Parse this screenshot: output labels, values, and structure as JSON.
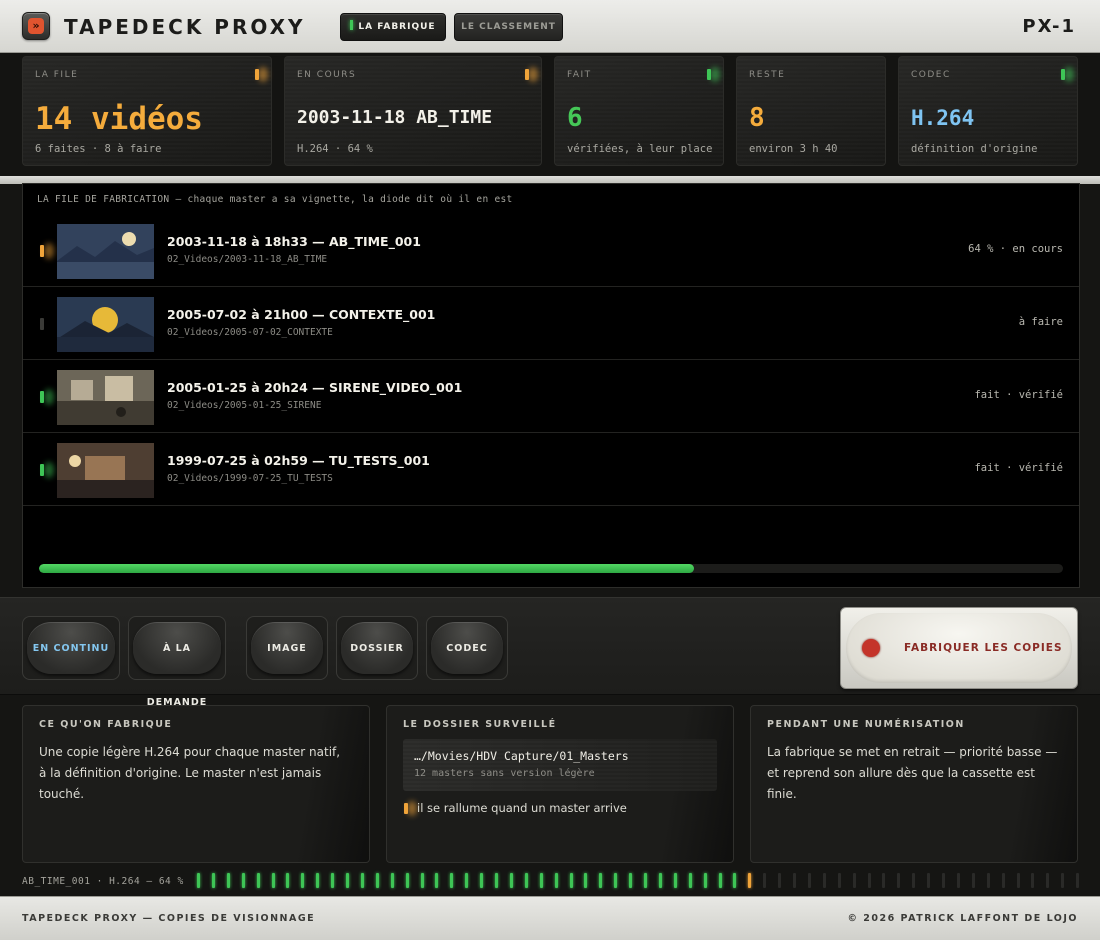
{
  "header": {
    "logo_glyph": "»",
    "title": "TAPEDECK PROXY",
    "nav": [
      {
        "label": "LA FABRIQUE",
        "active": true
      },
      {
        "label": "LE CLASSEMENT",
        "active": false
      }
    ],
    "model": "PX-1"
  },
  "stats": [
    {
      "label": "LA FILE",
      "value": "14 vidéos",
      "sub": "6 faites · 8 à faire",
      "led": "amber"
    },
    {
      "label": "EN COURS",
      "value": "2003-11-18 AB_TIME",
      "sub": "H.264 · 64 %",
      "led": "amber"
    },
    {
      "label": "FAIT",
      "value": "6",
      "sub": "vérifiées, à leur place",
      "led": "green"
    },
    {
      "label": "RESTE",
      "value": "8",
      "sub": "environ 3 h 40",
      "led": "none"
    },
    {
      "label": "CODEC",
      "value": "H.264",
      "sub": "définition d'origine",
      "led": "green"
    }
  ],
  "queue": {
    "caption": "LA FILE DE FABRICATION — chaque master a sa vignette, la diode dit où il en est",
    "items": [
      {
        "title": "2003-11-18 à 18h33 — AB_TIME_001",
        "path": "02_Videos/2003-11-18_AB_TIME",
        "status": "64 % · en cours",
        "led": "amber",
        "thumb": "night-mountains"
      },
      {
        "title": "2005-07-02 à 21h00 — CONTEXTE_001",
        "path": "02_Videos/2005-07-02_CONTEXTE",
        "status": "à faire",
        "led": "off",
        "thumb": "sunset-mountains"
      },
      {
        "title": "2005-01-25 à 20h24 — SIRENE_VIDEO_001",
        "path": "02_Videos/2005-01-25_SIRENE",
        "status": "fait · vérifié",
        "led": "green",
        "thumb": "room-frames"
      },
      {
        "title": "1999-07-25 à 02h59 — TU_TESTS_001",
        "path": "02_Videos/1999-07-25_TU_TESTS",
        "status": "fait · vérifié",
        "led": "green",
        "thumb": "lamp-room"
      }
    ],
    "progress": 0.64
  },
  "controls": {
    "modes": [
      {
        "label": "EN CONTINU",
        "active": true
      },
      {
        "label": "À LA DEMANDE",
        "active": false
      },
      {
        "label": "IMAGE",
        "active": false
      },
      {
        "label": "DOSSIER",
        "active": false
      },
      {
        "label": "CODEC",
        "active": false
      }
    ],
    "record_label": "FABRIQUER LES COPIES"
  },
  "info": {
    "what": {
      "heading": "CE QU'ON FABRIQUE",
      "body": "Une copie légère H.264 pour chaque master natif, à la définition d'origine. Le master n'est jamais touché."
    },
    "watched": {
      "heading": "LE DOSSIER SURVEILLÉ",
      "path": "…/Movies/HDV Capture/01_Masters",
      "count": "12 masters sans version légère",
      "note": "il se rallume quand un master arrive"
    },
    "during": {
      "heading": "PENDANT UNE NUMÉRISATION",
      "body": "La fabrique se met en retrait — priorité basse — et reprend son allure dès que la cassette est finie."
    }
  },
  "meter": {
    "label": "AB_TIME_001 · H.264 — 64 %",
    "level": 0.64,
    "colors": {
      "on": "#3ec556",
      "peak": "#f0a43a",
      "off": "#2a2a28"
    }
  },
  "footer": {
    "left": "TAPEDECK PROXY — COPIES DE VISIONNAGE",
    "right": "© 2026 PATRICK LAFFONT DE LOJO"
  }
}
